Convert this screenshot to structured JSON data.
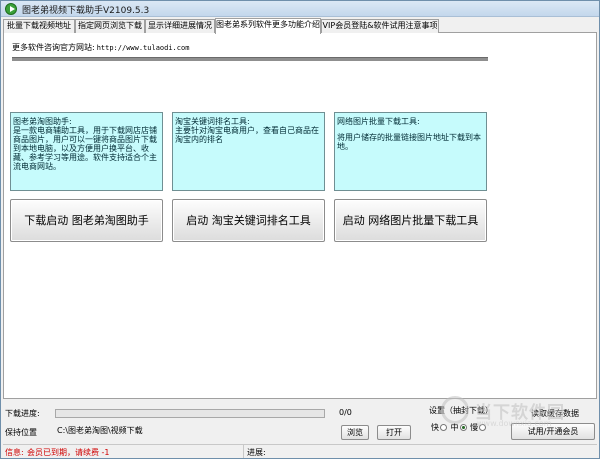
{
  "window": {
    "title": "图老弟视频下载助手V2109.5.3"
  },
  "tabs": [
    {
      "label": "批量下载视频地址",
      "active": false
    },
    {
      "label": "指定网页浏览下载",
      "active": false
    },
    {
      "label": "显示详细进展情况",
      "active": false
    },
    {
      "label": "图老弟系列软件更多功能介绍",
      "active": true
    },
    {
      "label": "VIP会员登陆&软件试用注意事项",
      "active": false
    }
  ],
  "site": {
    "label": "更多软件咨询官方网站:",
    "url": "http://www.tulaodi.com"
  },
  "cards": [
    {
      "title": "图老弟淘图助手:",
      "body": "是一款电商辅助工具，用于下载网店店铺商品图片，用户可以一键将商品图片下载到本地电脑，以及方便用户换平台、收藏、参考学习等用途。软件支持适合个主流电商网站。",
      "button": "下载启动 图老弟淘图助手"
    },
    {
      "title": "淘宝关键词排名工具:",
      "body": "主要针对淘宝电商用户，查看自己商品在淘宝内的排名",
      "button": "启动 淘宝关键词排名工具"
    },
    {
      "title": "网络图片批量下载工具:",
      "body": "将用户储存的批量链接图片地址下载到本地。",
      "button": "启动 网络图片批量下载工具"
    }
  ],
  "status": {
    "download_progress_label": "下载进度:",
    "progress_text": "0/0",
    "progress_fraction": 0,
    "save_location_label": "保持位置",
    "save_path": "C:\\图老弟淘图\\视频下载",
    "browse_button": "浏览",
    "open_button": "打开",
    "settings_label": "设置（抽封下载）",
    "speed_fast": "快",
    "speed_mid": "中",
    "speed_slow": "慢",
    "read_data_label": "读取缓存数据",
    "trial_button": "试用/开通会员",
    "info_label": "信息:",
    "info_text": "会员已到期，请续费 -1",
    "progress_label2": "进展:"
  },
  "watermark": {
    "text": "当下软件园",
    "sub": "www.downxia.com"
  },
  "colors": {
    "card_bg": "#c6fbfc",
    "accent": "#d00000"
  }
}
